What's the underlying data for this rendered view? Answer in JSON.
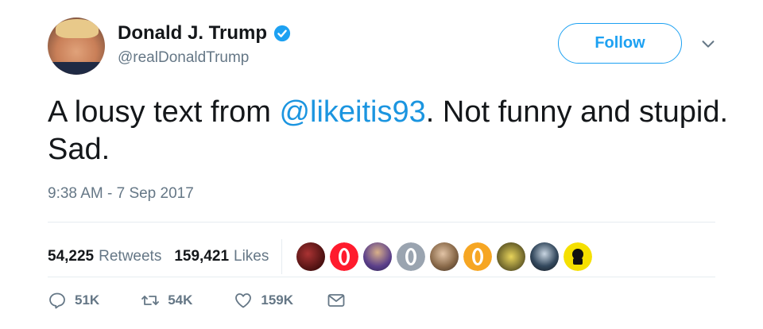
{
  "author": {
    "display_name": "Donald J. Trump",
    "handle": "@realDonaldTrump",
    "verified": true
  },
  "follow_button": {
    "label": "Follow"
  },
  "tweet": {
    "text_before": "A lousy text from ",
    "mention": "@likeitis93",
    "text_after": ". Not funny and stupid. Sad.",
    "timestamp": "9:38 AM - 7 Sep 2017"
  },
  "stats": {
    "retweets_count": "54,225",
    "retweets_label": "Retweets",
    "likes_count": "159,421",
    "likes_label": "Likes"
  },
  "likers": [
    {
      "icon": "liker-avatar-1",
      "color": "#6b1d1d"
    },
    {
      "icon": "opera-icon",
      "color": "#ff1b2d"
    },
    {
      "icon": "liker-avatar-3",
      "color": "#4a3a7a"
    },
    {
      "icon": "opera-icon",
      "color": "#9aa4b0"
    },
    {
      "icon": "liker-avatar-5",
      "color": "#8a6a4a"
    },
    {
      "icon": "opera-icon",
      "color": "#f6a623"
    },
    {
      "icon": "liker-avatar-7",
      "color": "#b7a84a"
    },
    {
      "icon": "liker-avatar-8",
      "color": "#2c3e50"
    },
    {
      "icon": "liker-avatar-9",
      "color": "#f5e000"
    }
  ],
  "actions": {
    "replies": "51K",
    "retweets": "54K",
    "likes": "159K"
  },
  "colors": {
    "accent": "#1da1f2",
    "mention": "#1b95e0",
    "secondary_text": "#657786",
    "divider": "#e6ecf0"
  }
}
